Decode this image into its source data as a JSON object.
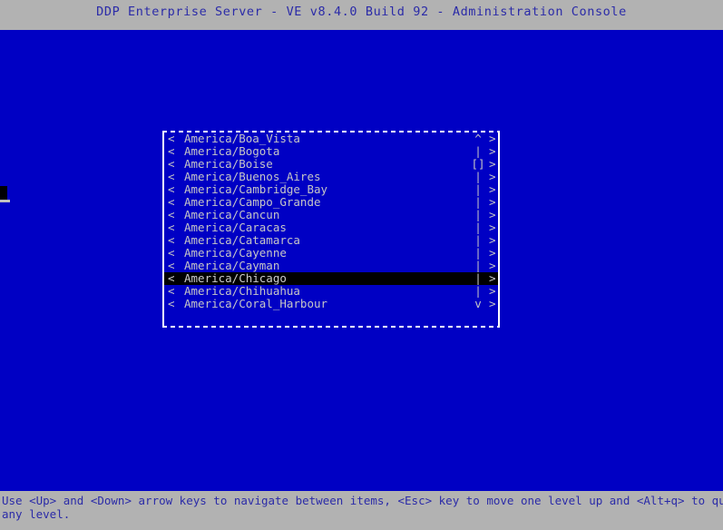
{
  "window": {
    "title": "DDP Enterprise Server - VE v8.4.0 Build 92 - Administration Console"
  },
  "colors": {
    "background_blue": "#0000c4",
    "bar_gray": "#b2b2b2",
    "bar_text_blue": "#2b2ba8",
    "list_text": "#c6c6c6",
    "selection_background": "#000000",
    "selection_text": "#cccccc",
    "border_white": "#ffffff"
  },
  "menu": {
    "selected_index": 11,
    "items": [
      {
        "left_arrow": "<",
        "label": "America/Boa_Vista",
        "scroll": "^",
        "right_arrow": ">",
        "selected": false
      },
      {
        "left_arrow": "<",
        "label": "America/Bogota",
        "scroll": "|",
        "right_arrow": ">",
        "selected": false
      },
      {
        "left_arrow": "<",
        "label": "America/Boise",
        "scroll": "[]",
        "right_arrow": ">",
        "selected": false
      },
      {
        "left_arrow": "<",
        "label": "America/Buenos_Aires",
        "scroll": "|",
        "right_arrow": ">",
        "selected": false
      },
      {
        "left_arrow": "<",
        "label": "America/Cambridge_Bay",
        "scroll": "|",
        "right_arrow": ">",
        "selected": false
      },
      {
        "left_arrow": "<",
        "label": "America/Campo_Grande",
        "scroll": "|",
        "right_arrow": ">",
        "selected": false
      },
      {
        "left_arrow": "<",
        "label": "America/Cancun",
        "scroll": "|",
        "right_arrow": ">",
        "selected": false
      },
      {
        "left_arrow": "<",
        "label": "America/Caracas",
        "scroll": "|",
        "right_arrow": ">",
        "selected": false
      },
      {
        "left_arrow": "<",
        "label": "America/Catamarca",
        "scroll": "|",
        "right_arrow": ">",
        "selected": false
      },
      {
        "left_arrow": "<",
        "label": "America/Cayenne",
        "scroll": "|",
        "right_arrow": ">",
        "selected": false
      },
      {
        "left_arrow": "<",
        "label": "America/Cayman",
        "scroll": "|",
        "right_arrow": ">",
        "selected": false
      },
      {
        "left_arrow": "<",
        "label": "America/Chicago",
        "scroll": "|",
        "right_arrow": ">",
        "selected": true
      },
      {
        "left_arrow": "<",
        "label": "America/Chihuahua",
        "scroll": "|",
        "right_arrow": ">",
        "selected": false
      },
      {
        "left_arrow": "<",
        "label": "America/Coral_Harbour",
        "scroll": "v",
        "right_arrow": ">",
        "selected": false
      }
    ]
  },
  "status_bar": {
    "line1": "Use <Up> and <Down> arrow keys to navigate between items, <Esc> key to move one level up and <Alt+q> to quit at",
    "line2": "any level."
  }
}
